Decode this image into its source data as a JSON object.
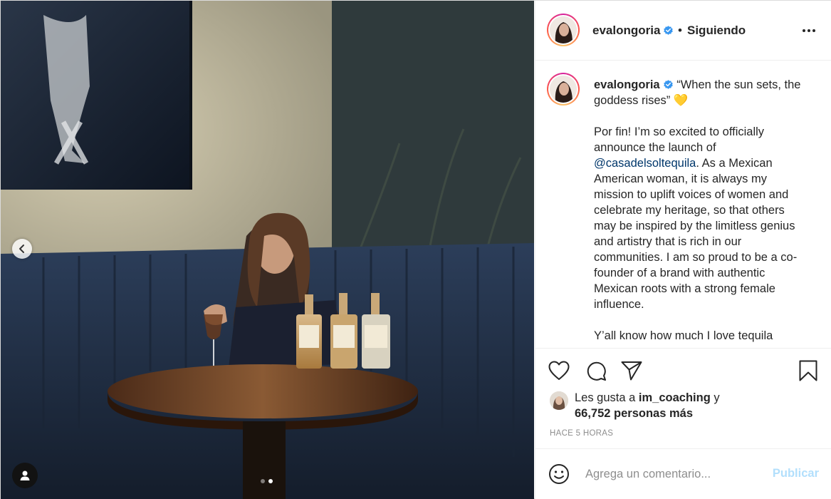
{
  "post": {
    "username": "evalongoria",
    "separator": "•",
    "follow_status": "Siguiendo",
    "more_icon": "more-options-icon",
    "verified_color": "#3897f0"
  },
  "media": {
    "prev_icon": "chevron-left-icon",
    "user_tag_icon": "user-icon",
    "carousel": {
      "total": 2,
      "active_index": 1
    }
  },
  "caption": {
    "username": "evalongoria",
    "headline": "“When the sun sets, the goddess rises” 💛",
    "para1_before": "Por fin! I’m so excited to officially announce the launch of ",
    "mention": "@casadelsoltequila",
    "para1_after": ". As a Mexican American woman, it is always my mission to uplift voices of women and celebrate my heritage, so that others may be inspired by the limitless genius and artistry that is rich in our communities. I am so proud to be a co-founder of a brand with authentic Mexican roots with a strong female influence.",
    "para2": "Y’all know how much I love tequila"
  },
  "actions": {
    "like_icon": "heart-icon",
    "comment_icon": "comment-icon",
    "share_icon": "send-icon",
    "save_icon": "bookmark-icon"
  },
  "likes": {
    "prefix": "Les gusta a ",
    "user": "im_coaching",
    "connector": " y",
    "count": "66,752 personas más"
  },
  "timestamp": "HACE 5 HORAS",
  "add_comment": {
    "emoji_icon": "smiley-icon",
    "placeholder": "Agrega un comentario...",
    "post_label": "Publicar",
    "post_color": "#b2dffc"
  }
}
